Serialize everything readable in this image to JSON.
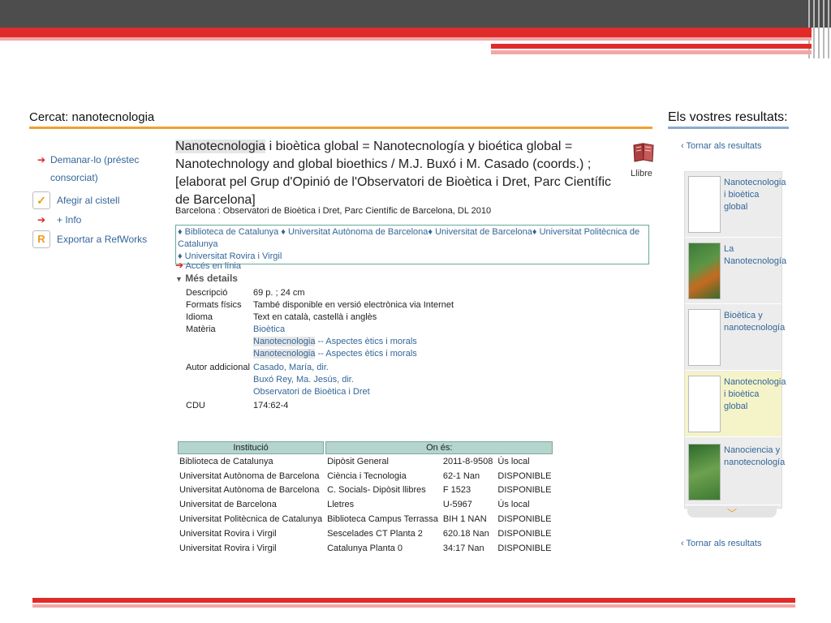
{
  "search_heading": "Cercat: nanotecnologia",
  "results_heading": "Els vostres resultats:",
  "actions": [
    {
      "label": "Demanar-lo (préstec consorciat)",
      "icon": "arrow-icon"
    },
    {
      "label": "Afegir al cistell",
      "icon": "checkmark-icon"
    },
    {
      "label": "+ Info",
      "icon": "arrow-icon"
    },
    {
      "label": "Exportar a RefWorks",
      "icon": "refworks-icon"
    }
  ],
  "record": {
    "title_highlight": "Nanotecnologia",
    "title_rest": " i bioètica global = Nanotecnología y bioética global = Nanotechnology and global bioethics / M.J. Buxó i M. Casado (coords.) ; [elaborat pel Grup d'Opinió de l'Observatori de Bioètica i Dret, Parc Científic de Barcelona]",
    "publication": "Barcelona : Observatori de Bioètica i Dret, Parc Científic de Barcelona, DL 2010",
    "format_label": "Llibre",
    "holdings_line1": "♦ Biblioteca de Catalunya ♦ Universitat Autònoma de Barcelona♦ Universitat de Barcelona♦ Universitat Politècnica de Catalunya",
    "holdings_line2": "♦ Universitat Rovira i Virgil",
    "access_label": "Accés en línia",
    "more_details_label": "Més details",
    "details": {
      "descripcio_label": "Descripció",
      "descripcio": "69 p. ; 24 cm",
      "formats_label": "Formats físics",
      "formats": "També disponible en versió electrònica via Internet",
      "idioma_label": "Idioma",
      "idioma": "Text en català, castellà i anglès",
      "materia_label": "Matèria",
      "materia_1": "Bioètica",
      "materia_2_hl": "Nanotecnologia",
      "materia_2_rest": " -- Aspectes ètics i morals",
      "materia_3_hl": "Nanotecnologia",
      "materia_3_rest": " -- Aspectes ètics i morals",
      "autor_label": "Autor addicional",
      "autor_1": "Casado, María, dir.",
      "autor_2": "Buxó Rey, Ma. Jesús, dir.",
      "autor_3": "Observatori de Bioètica i Dret",
      "cdu_label": "CDU",
      "cdu": "174:62-4"
    }
  },
  "holdings_table": {
    "header_institucio": "Institució",
    "header_on_es": "On és:",
    "rows": [
      [
        "Biblioteca de Catalunya",
        "Dipòsit General",
        "2011-8-9508",
        "Ús local"
      ],
      [
        "Universitat Autònoma de Barcelona",
        "Ciència i Tecnologia",
        "62-1 Nan",
        "DISPONIBLE"
      ],
      [
        "Universitat Autònoma de Barcelona",
        "C. Socials- Dipòsit llibres",
        "F 1523",
        "DISPONIBLE"
      ],
      [
        "Universitat de Barcelona",
        "Lletres",
        "U-5967",
        "Ús local"
      ],
      [
        "Universitat Politècnica de Catalunya",
        "Biblioteca Campus Terrassa",
        "BIH 1 NAN",
        "DISPONIBLE"
      ],
      [
        "Universitat Rovira i Virgil",
        "Sescelades CT Planta 2",
        "620.18 Nan",
        "DISPONIBLE"
      ],
      [
        "Universitat Rovira i Virgil",
        "Catalunya Planta 0",
        "34:17 Nan",
        "DISPONIBLE"
      ]
    ]
  },
  "sidebar": {
    "back_label": "Tornar als resultats",
    "results": [
      {
        "title": "Nanotecnologia i bioètica global"
      },
      {
        "title": "La Nanotecnología"
      },
      {
        "title": "Bioètica y nanotecnología"
      },
      {
        "title": "Nanotecnologia i bioètica global"
      },
      {
        "title": "Nanociencia y nanotecnología"
      }
    ]
  }
}
